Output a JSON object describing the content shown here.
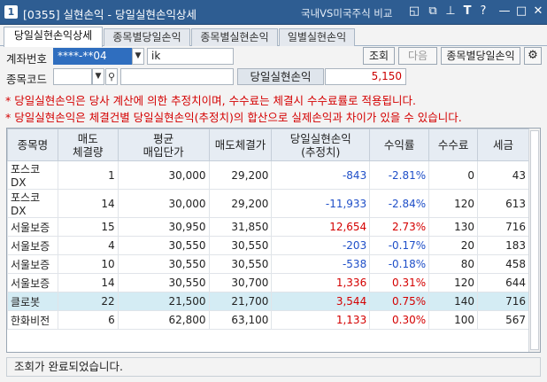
{
  "window": {
    "number": "1",
    "title": "[0355] 실현손익 - 당일실현손익상세",
    "subtitle": "국내VS미국주식 비교"
  },
  "tabs": [
    {
      "label": "당일실현손익상세",
      "active": true
    },
    {
      "label": "종목별당일손익",
      "active": false
    },
    {
      "label": "종목별실현손익",
      "active": false
    },
    {
      "label": "일별실현손익",
      "active": false
    }
  ],
  "form": {
    "account_label": "계좌번호",
    "account_value": "****-**04",
    "account_name": "ik",
    "code_label": "종목코드",
    "code_value": "",
    "sum_label": "당일실현손익",
    "sum_value": "5,150",
    "query_button": "조회",
    "next_button": "다음",
    "by_item_button": "종목별당일손익"
  },
  "notices": [
    "* 당일실현손익은 당사 계산에 의한 추정치이며, 수수료는 체결시 수수료률로 적용됩니다.",
    "* 당일실현손익은 체결건별 당일실현손익(추정치)의 합산으로 실제손익과 차이가 있을 수 있습니다."
  ],
  "table": {
    "headers": [
      "종목명",
      "매도\n체결량",
      "평균\n매입단가",
      "매도체결가",
      "당일실현손익\n(추정치)",
      "수익률",
      "수수료",
      "세금"
    ],
    "rows": [
      {
        "name": "포스코DX",
        "qty": "1",
        "avg": "30,000",
        "sell": "29,200",
        "pnl": "-843",
        "rate": "-2.81%",
        "fee": "0",
        "tax": "43",
        "sign": "neg"
      },
      {
        "name": "포스코DX",
        "qty": "14",
        "avg": "30,000",
        "sell": "29,200",
        "pnl": "-11,933",
        "rate": "-2.84%",
        "fee": "120",
        "tax": "613",
        "sign": "neg"
      },
      {
        "name": "서울보증",
        "qty": "15",
        "avg": "30,950",
        "sell": "31,850",
        "pnl": "12,654",
        "rate": "2.73%",
        "fee": "130",
        "tax": "716",
        "sign": "pos"
      },
      {
        "name": "서울보증",
        "qty": "4",
        "avg": "30,550",
        "sell": "30,550",
        "pnl": "-203",
        "rate": "-0.17%",
        "fee": "20",
        "tax": "183",
        "sign": "neg"
      },
      {
        "name": "서울보증",
        "qty": "10",
        "avg": "30,550",
        "sell": "30,550",
        "pnl": "-538",
        "rate": "-0.18%",
        "fee": "80",
        "tax": "458",
        "sign": "neg"
      },
      {
        "name": "서울보증",
        "qty": "14",
        "avg": "30,550",
        "sell": "30,700",
        "pnl": "1,336",
        "rate": "0.31%",
        "fee": "120",
        "tax": "644",
        "sign": "pos"
      },
      {
        "name": "클로봇",
        "qty": "22",
        "avg": "21,500",
        "sell": "21,700",
        "pnl": "3,544",
        "rate": "0.75%",
        "fee": "140",
        "tax": "716",
        "sign": "pos",
        "highlight": true
      },
      {
        "name": "한화비전",
        "qty": "6",
        "avg": "62,800",
        "sell": "63,100",
        "pnl": "1,133",
        "rate": "0.30%",
        "fee": "100",
        "tax": "567",
        "sign": "pos"
      }
    ]
  },
  "status": "조회가 완료되었습니다.",
  "colors": {
    "titlebar": "#2e5d92",
    "negative": "#1f4fc8",
    "positive": "#d40000",
    "highlight_row": "#d4ecf4"
  }
}
